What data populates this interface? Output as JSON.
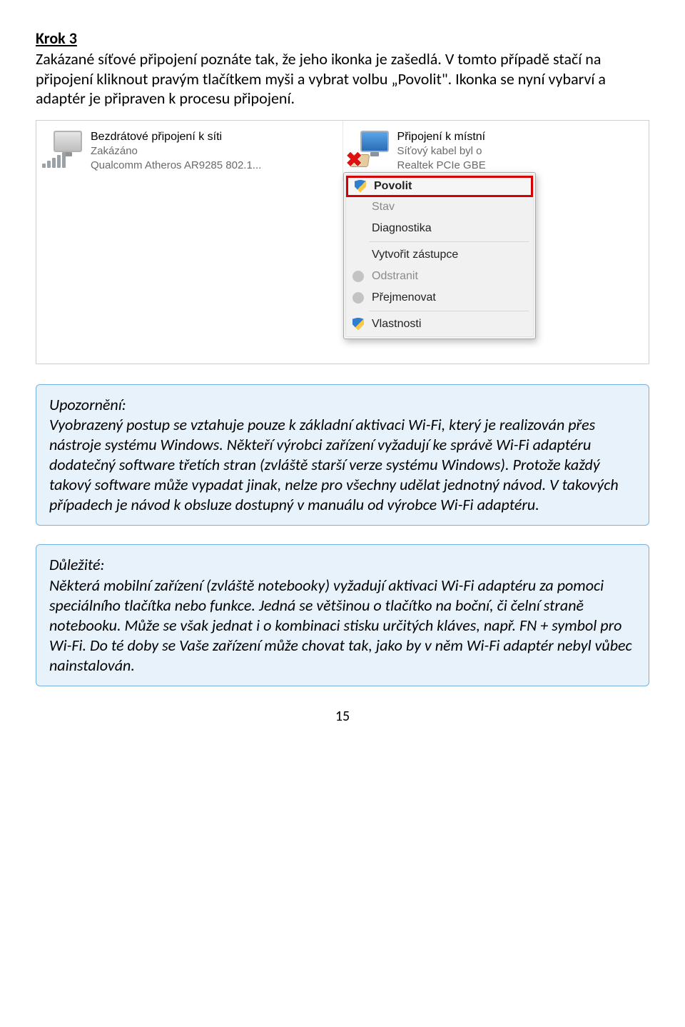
{
  "heading": "Krok 3",
  "intro": "Zakázané síťové připojení poznáte tak, že jeho ikonka je zašedlá. V tomto případě stačí na připojení kliknout pravým tlačítkem myši a vybrat volbu „Povolit\". Ikonka se nyní vybarví a adaptér je připraven k procesu připojení.",
  "screenshot": {
    "adapter1": {
      "title": "Bezdrátové připojení k síti",
      "status": "Zakázáno",
      "device": "Qualcomm Atheros AR9285 802.1..."
    },
    "adapter2": {
      "title": "Připojení k místní",
      "status": "Síťový kabel byl o",
      "device": "Realtek PCIe GBE"
    },
    "menu": {
      "povolit": "Povolit",
      "stav": "Stav",
      "diagnostika": "Diagnostika",
      "vytvorit": "Vytvořit zástupce",
      "odstranit": "Odstranit",
      "prejmenovat": "Přejmenovat",
      "vlastnosti": "Vlastnosti"
    }
  },
  "box1": {
    "label": "Upozornění:",
    "text": "Vyobrazený postup se vztahuje pouze k základní aktivaci Wi-Fi, který je realizován přes nástroje systému Windows. Někteří výrobci zařízení vyžadují ke správě Wi-Fi adaptéru dodatečný software třetích stran (zvláště starší verze systému Windows). Protože každý takový software může vypadat jinak, nelze pro všechny udělat jednotný návod. V takových případech je návod k obsluze dostupný v manuálu od výrobce Wi-Fi adaptéru."
  },
  "box2": {
    "label": "Důležité:",
    "text": "Některá mobilní zařízení (zvláště notebooky) vyžadují aktivaci Wi-Fi adaptéru za pomoci speciálního tlačítka nebo funkce. Jedná se většinou o tlačítko na boční, či čelní straně notebooku. Může se však jednat i o kombinaci stisku určitých kláves, např. FN + symbol pro Wi-Fi. Do té doby se Vaše zařízení může chovat tak, jako by v něm Wi-Fi adaptér nebyl vůbec nainstalován."
  },
  "page": "15"
}
